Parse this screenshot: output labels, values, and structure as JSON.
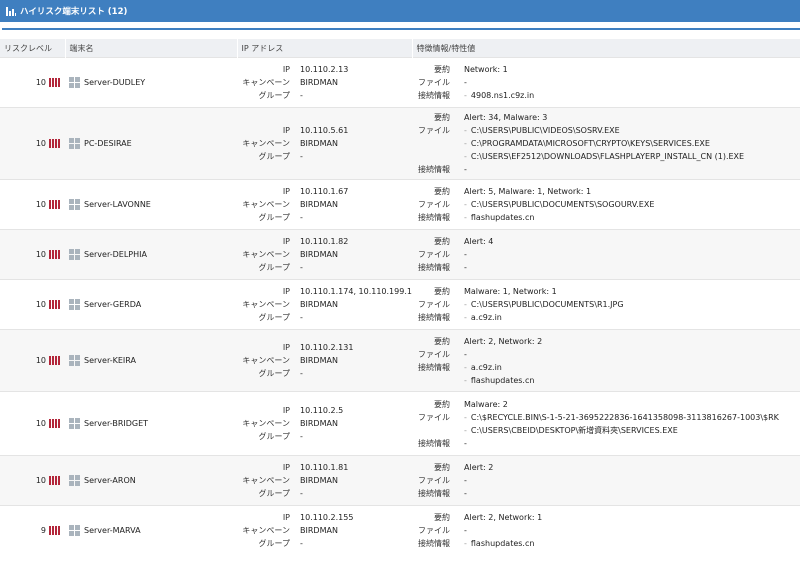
{
  "header": {
    "title": "ハイリスク端末リスト (12)"
  },
  "table": {
    "columns": [
      "リスクレベル",
      "端末名",
      "IP アドレス",
      "特徴情報/特性値"
    ],
    "field_labels": {
      "ip": "IP",
      "campaign": "キャンペーン",
      "group": "グループ",
      "summary": "要約",
      "file": "ファイル",
      "connection": "接続情報"
    },
    "bullet": "-",
    "rows": [
      {
        "risk": "10",
        "bars": 4,
        "host": "Server-DUDLEY",
        "ip": "10.110.2.13",
        "campaign": "BIRDMAN",
        "group": "-",
        "summary": "Network: 1",
        "files": [],
        "file_empty": "-",
        "connections": [
          "4908.ns1.c9z.in"
        ],
        "conn_empty": ""
      },
      {
        "risk": "10",
        "bars": 4,
        "host": "PC-DESIRAE",
        "ip": "10.110.5.61",
        "campaign": "BIRDMAN",
        "group": "-",
        "summary": "Alert: 34, Malware: 3",
        "files": [
          "C:\\USERS\\PUBLIC\\VIDEOS\\SOSRV.EXE",
          "C:\\PROGRAMDATA\\MICROSOFT\\CRYPTO\\KEYS\\SERVICES.EXE",
          "C:\\USERS\\EF2512\\DOWNLOADS\\FLASHPLAYERP_INSTALL_CN (1).EXE"
        ],
        "file_empty": "",
        "connections": [],
        "conn_empty": "-"
      },
      {
        "risk": "10",
        "bars": 4,
        "host": "Server-LAVONNE",
        "ip": "10.110.1.67",
        "campaign": "BIRDMAN",
        "group": "-",
        "summary": "Alert: 5, Malware: 1, Network: 1",
        "files": [
          "C:\\USERS\\PUBLIC\\DOCUMENTS\\SOGOURV.EXE"
        ],
        "file_empty": "",
        "connections": [
          "flashupdates.cn"
        ],
        "conn_empty": ""
      },
      {
        "risk": "10",
        "bars": 4,
        "host": "Server-DELPHIA",
        "ip": "10.110.1.82",
        "campaign": "BIRDMAN",
        "group": "-",
        "summary": "Alert: 4",
        "files": [],
        "file_empty": "-",
        "connections": [],
        "conn_empty": "-"
      },
      {
        "risk": "10",
        "bars": 4,
        "host": "Server-GERDA",
        "ip": "10.110.1.174, 10.110.199.174",
        "campaign": "BIRDMAN",
        "group": "-",
        "summary": "Malware: 1, Network: 1",
        "files": [
          "C:\\USERS\\PUBLIC\\DOCUMENTS\\R1.JPG"
        ],
        "file_empty": "",
        "connections": [
          "a.c9z.in"
        ],
        "conn_empty": ""
      },
      {
        "risk": "10",
        "bars": 4,
        "host": "Server-KEIRA",
        "ip": "10.110.2.131",
        "campaign": "BIRDMAN",
        "group": "-",
        "summary": "Alert: 2, Network: 2",
        "files": [],
        "file_empty": "-",
        "connections": [
          "a.c9z.in",
          "flashupdates.cn"
        ],
        "conn_empty": ""
      },
      {
        "risk": "10",
        "bars": 4,
        "host": "Server-BRIDGET",
        "ip": "10.110.2.5",
        "campaign": "BIRDMAN",
        "group": "-",
        "summary": "Malware: 2",
        "files": [
          "C:\\$RECYCLE.BIN\\S-1-5-21-3695222836-1641358098-3113816267-1003\\$RK",
          "C:\\USERS\\CBEID\\DESKTOP\\新增資料夾\\SERVICES.EXE"
        ],
        "file_empty": "",
        "connections": [],
        "conn_empty": "-"
      },
      {
        "risk": "10",
        "bars": 4,
        "host": "Server-ARON",
        "ip": "10.110.1.81",
        "campaign": "BIRDMAN",
        "group": "-",
        "summary": "Alert: 2",
        "files": [],
        "file_empty": "-",
        "connections": [],
        "conn_empty": "-"
      },
      {
        "risk": "9",
        "bars": 4,
        "host": "Server-MARVA",
        "ip": "10.110.2.155",
        "campaign": "BIRDMAN",
        "group": "-",
        "summary": "Alert: 2, Network: 1",
        "files": [],
        "file_empty": "-",
        "connections": [
          "flashupdates.cn"
        ],
        "conn_empty": ""
      }
    ]
  }
}
